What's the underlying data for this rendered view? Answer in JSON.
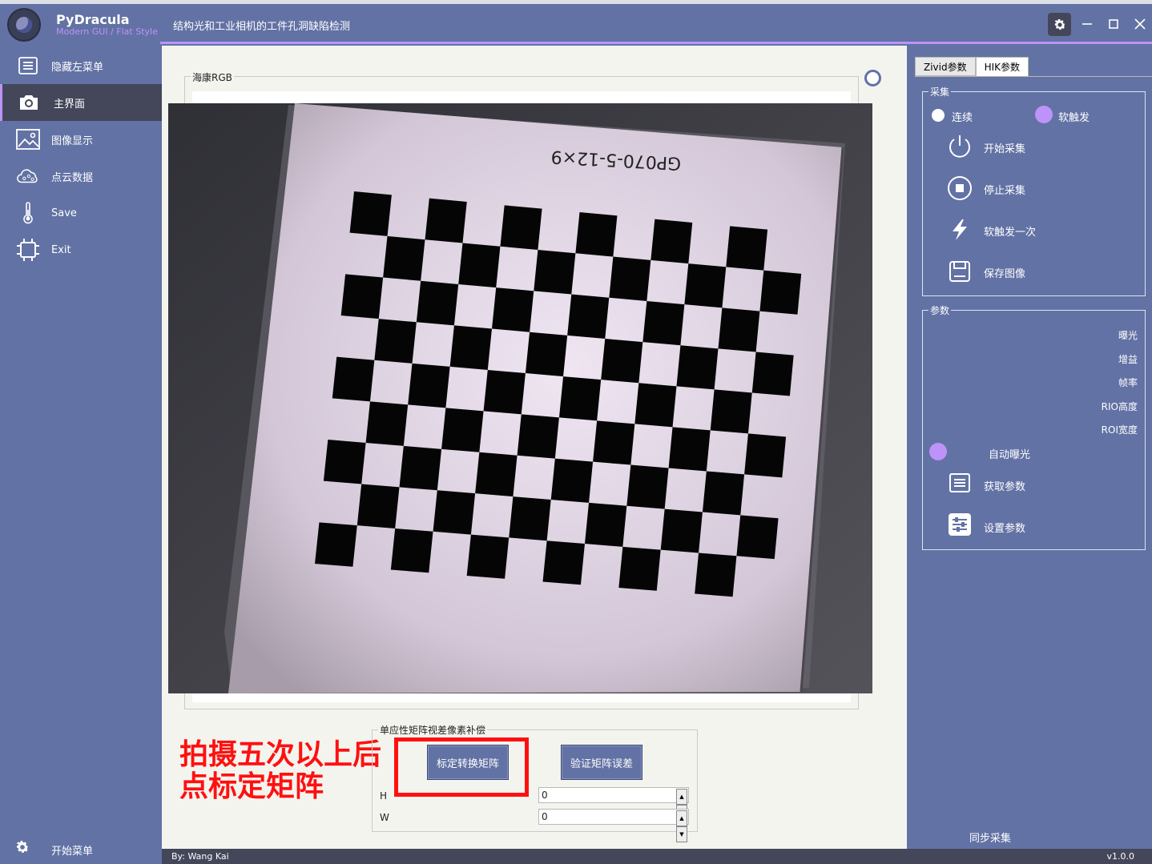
{
  "app": {
    "name": "PyDracula",
    "subtitle": "Modern GUI / Flat Style",
    "description": "结构光和工业相机的工件孔洞缺陷检测"
  },
  "left_menu": {
    "items": [
      {
        "label": "隐藏左菜单",
        "icon": "menu-lines-icon"
      },
      {
        "label": "主界面",
        "icon": "camera-icon"
      },
      {
        "label": "图像显示",
        "icon": "image-icon"
      },
      {
        "label": "点云数据",
        "icon": "cloud-icon"
      },
      {
        "label": "Save",
        "icon": "thermometer-icon"
      },
      {
        "label": "Exit",
        "icon": "chip-icon"
      }
    ],
    "bottom": {
      "label": "开始菜单",
      "icon": "gear-icon"
    }
  },
  "content": {
    "image_group_title": "海康RGB",
    "chessboard_label": "GP070-5-12×9",
    "annotation_line1": "拍摄五次以上后",
    "annotation_line2": "点标定矩阵",
    "calib_group_title": "单应性矩阵视差像素补偿",
    "calibrate_button": "标定转换矩阵",
    "verify_button": "验证矩阵误差",
    "h_label": "H",
    "h_value": "0",
    "w_label": "W",
    "w_value": "0"
  },
  "right_panel": {
    "tabs": [
      "Zivid参数",
      "HIK参数"
    ],
    "active_tab": 1,
    "capture_group_title": "采集",
    "mode_continuous": "连续",
    "mode_soft": "软触发",
    "start_capture": "开始采集",
    "stop_capture": "停止采集",
    "soft_trigger_once": "软触发一次",
    "save_image": "保存图像",
    "params_group_title": "参数",
    "param_exposure": "曝光",
    "param_gain": "增益",
    "param_framerate": "帧率",
    "param_rio_height": "RIO高度",
    "param_roi_width": "ROI宽度",
    "auto_exposure": "自动曝光",
    "get_params": "获取参数",
    "set_params": "设置参数",
    "sync_capture": "同步采集"
  },
  "statusbar": {
    "credit": "By: Wang Kai",
    "version": "v1.0.0"
  },
  "colors": {
    "primary": "#6272a4",
    "accent": "#bd93f9",
    "dark": "#44475a",
    "annotation": "#ff1010"
  }
}
